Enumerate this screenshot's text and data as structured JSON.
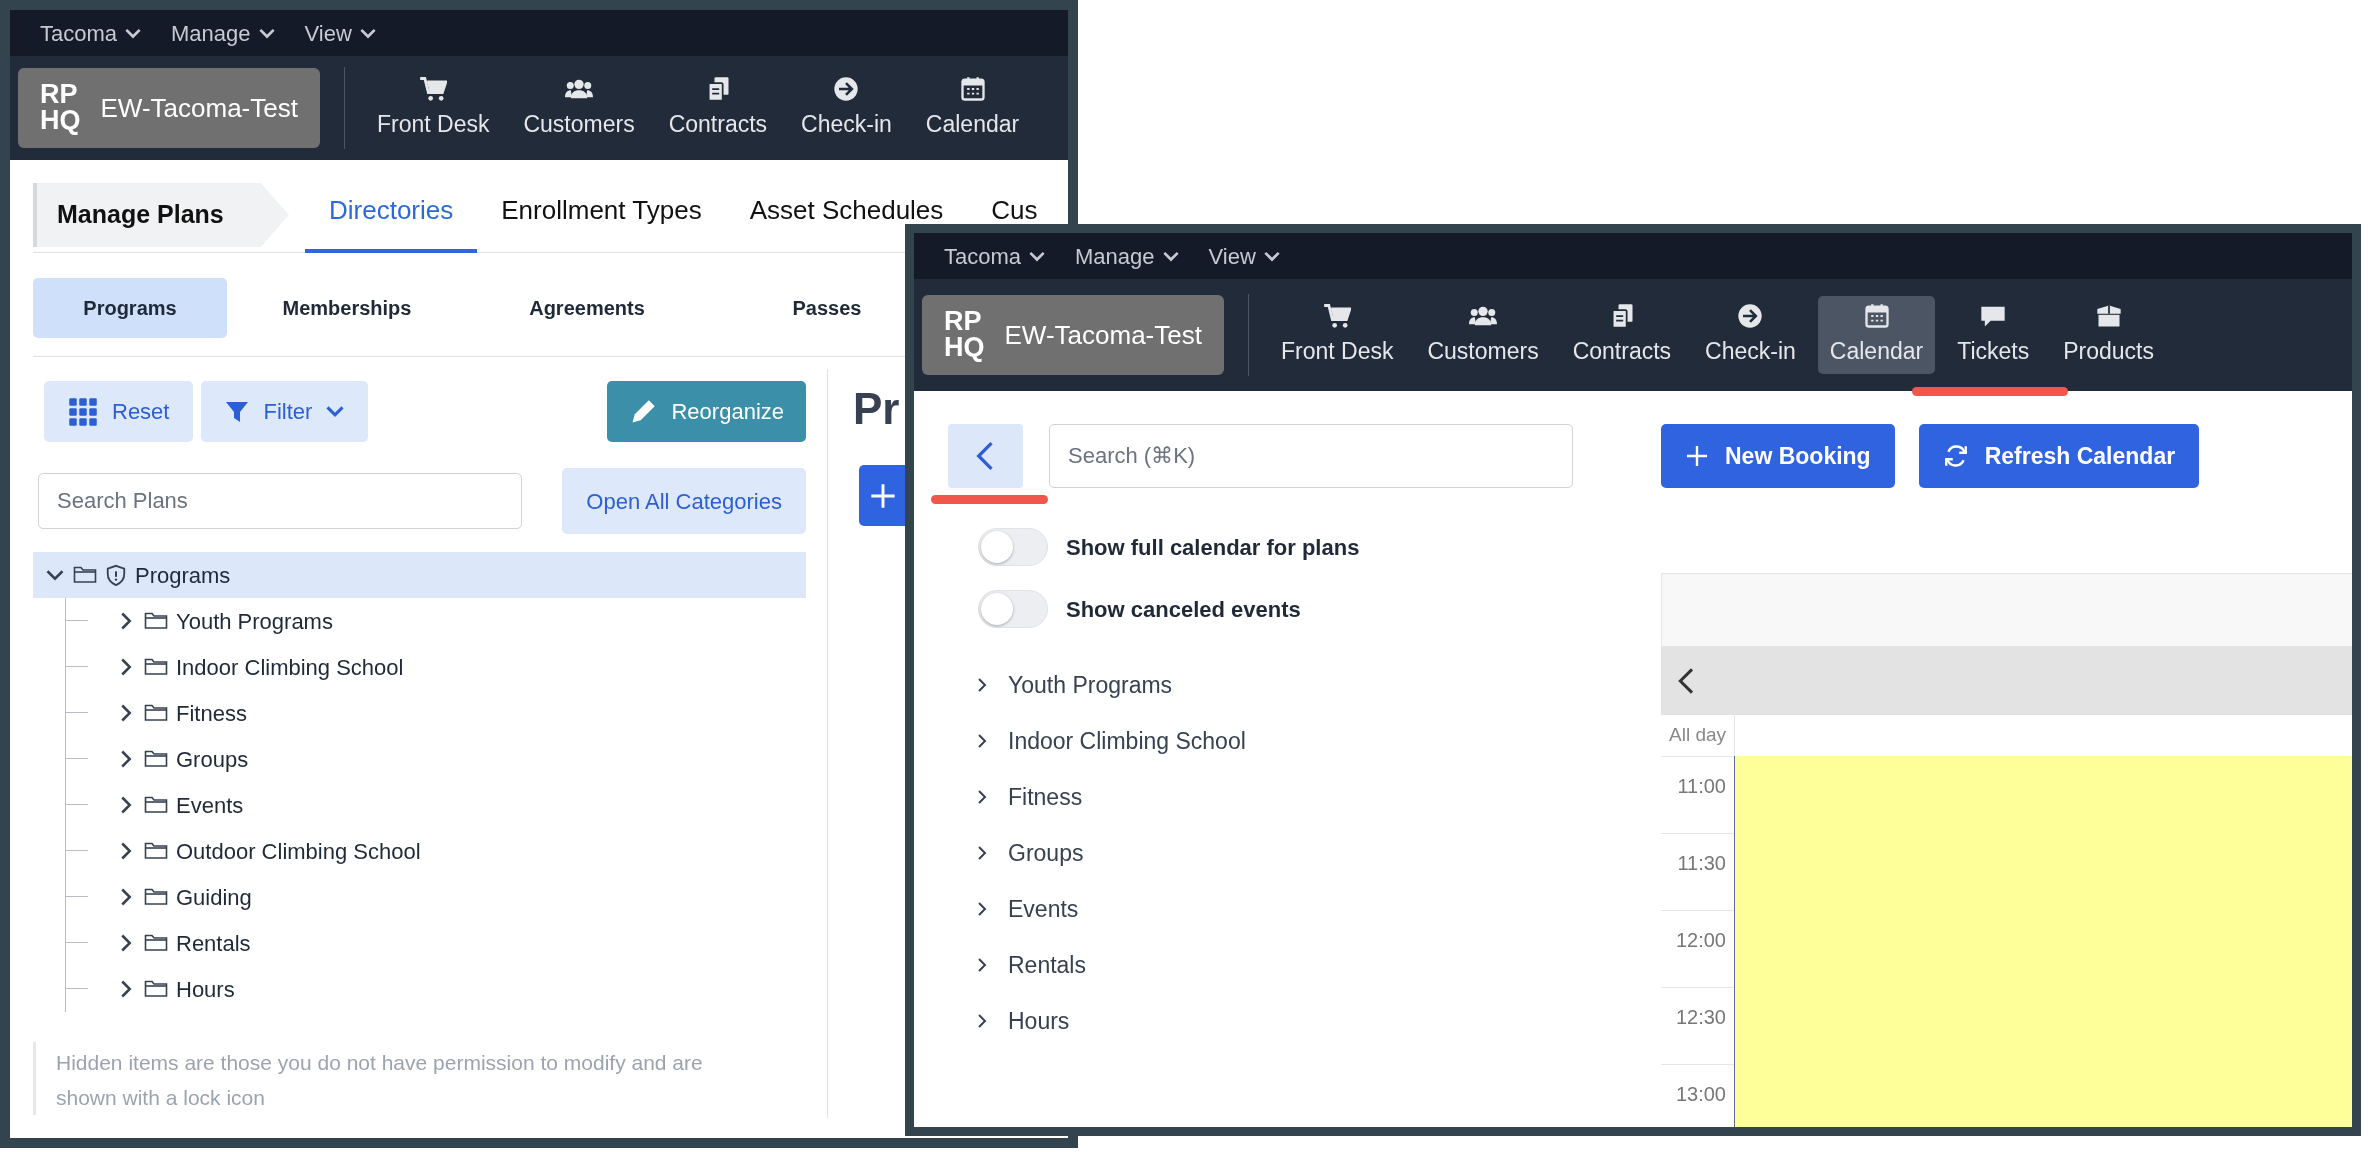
{
  "plans_window": {
    "menu": [
      {
        "label": "Tacoma"
      },
      {
        "label": "Manage"
      },
      {
        "label": "View"
      }
    ],
    "brand": {
      "logo": [
        "RP",
        "HQ"
      ],
      "name": "EW-Tacoma-Test"
    },
    "nav": [
      {
        "label": "Front Desk",
        "kind": "cart",
        "selected": false
      },
      {
        "label": "Customers",
        "kind": "people",
        "selected": false
      },
      {
        "label": "Contracts",
        "kind": "contracts",
        "selected": false
      },
      {
        "label": "Check-in",
        "kind": "checkin",
        "selected": false
      },
      {
        "label": "Calendar",
        "kind": "calendar",
        "selected": false
      }
    ],
    "breadcrumb": "Manage Plans",
    "tabs": [
      {
        "label": "Directories",
        "selected": true
      },
      {
        "label": "Enrollment Types",
        "selected": false
      },
      {
        "label": "Asset Schedules",
        "selected": false
      },
      {
        "label": "Cus",
        "selected": false
      }
    ],
    "subtabs": [
      {
        "label": "Programs",
        "selected": true
      },
      {
        "label": "Memberships",
        "selected": false
      },
      {
        "label": "Agreements",
        "selected": false
      },
      {
        "label": "Passes",
        "selected": false
      }
    ],
    "toolbar": {
      "reset": "Reset",
      "filter": "Filter",
      "reorganize": "Reorganize"
    },
    "search": {
      "placeholder": "Search Plans"
    },
    "open_all": "Open All Categories",
    "tree": [
      {
        "label": "Programs",
        "kind": "shielded",
        "selected": true,
        "expanded": true,
        "children": [
          {
            "label": "Youth Programs",
            "kind": "plain",
            "selected": false,
            "expanded": false
          },
          {
            "label": "Indoor Climbing School",
            "kind": "plain",
            "selected": false,
            "expanded": false
          },
          {
            "label": "Fitness",
            "kind": "plain",
            "selected": false,
            "expanded": false
          },
          {
            "label": "Groups",
            "kind": "plain",
            "selected": false,
            "expanded": false
          },
          {
            "label": "Events",
            "kind": "plain",
            "selected": false,
            "expanded": false
          },
          {
            "label": "Outdoor Climbing School",
            "kind": "plain",
            "selected": false,
            "expanded": false
          },
          {
            "label": "Guiding",
            "kind": "plain",
            "selected": false,
            "expanded": false
          },
          {
            "label": "Rentals",
            "kind": "plain",
            "selected": false,
            "expanded": false
          },
          {
            "label": "Hours",
            "kind": "plain",
            "selected": false,
            "expanded": false
          }
        ]
      }
    ],
    "note": "Hidden items are those you do not have permission to modify and are shown with a lock icon",
    "heading": "Pr"
  },
  "calendar_window": {
    "menu": [
      {
        "label": "Tacoma"
      },
      {
        "label": "Manage"
      },
      {
        "label": "View"
      }
    ],
    "brand": {
      "logo": [
        "RP",
        "HQ"
      ],
      "name": "EW-Tacoma-Test"
    },
    "nav": [
      {
        "label": "Front Desk",
        "kind": "cart",
        "selected": false
      },
      {
        "label": "Customers",
        "kind": "people",
        "selected": false
      },
      {
        "label": "Contracts",
        "kind": "contracts",
        "selected": false
      },
      {
        "label": "Check-in",
        "kind": "checkin",
        "selected": false
      },
      {
        "label": "Calendar",
        "kind": "calendar",
        "selected": true
      },
      {
        "label": "Tickets",
        "kind": "tickets",
        "selected": false
      },
      {
        "label": "Products",
        "kind": "products",
        "selected": false
      }
    ],
    "search": {
      "placeholder": "Search (⌘K)"
    },
    "toggles": [
      {
        "label": "Show full calendar for plans",
        "on": false
      },
      {
        "label": "Show canceled events",
        "on": false
      }
    ],
    "categories": [
      {
        "label": "Youth Programs",
        "expanded": false
      },
      {
        "label": "Indoor Climbing School",
        "expanded": false
      },
      {
        "label": "Fitness",
        "expanded": false
      },
      {
        "label": "Groups",
        "expanded": false
      },
      {
        "label": "Events",
        "expanded": false
      },
      {
        "label": "Rentals",
        "expanded": false
      },
      {
        "label": "Hours",
        "expanded": false
      }
    ],
    "buttons": {
      "new_booking": "New Booking",
      "refresh": "Refresh Calendar"
    },
    "calendar": {
      "all_day": "All day",
      "times": [
        "11:00",
        "11:30",
        "12:00",
        "12:30",
        "13:00"
      ]
    }
  }
}
